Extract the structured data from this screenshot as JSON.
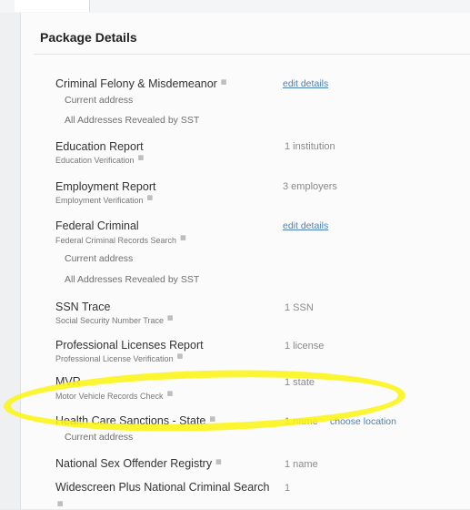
{
  "section": {
    "title": "Package Details"
  },
  "items": [
    {
      "name": "Criminal Felony & Misdemeanor",
      "link": "edit details",
      "lines": [
        "Current address",
        "All Addresses Revealed by SST"
      ]
    },
    {
      "name": "Education Report",
      "sub": "Education Verification",
      "value": "1 institution"
    },
    {
      "name": "Employment Report",
      "sub": "Employment Verification",
      "value": "3 employers"
    },
    {
      "name": "Federal Criminal",
      "sub": "Federal Criminal Records Search",
      "link": "edit details",
      "lines": [
        "Current address",
        "All Addresses Revealed by SST"
      ]
    },
    {
      "name": "SSN Trace",
      "sub": "Social Security Number Trace",
      "value": "1 SSN"
    },
    {
      "name": "Professional Licenses Report",
      "sub": "Professional License Verification",
      "value": "1 license"
    },
    {
      "name": "MVR",
      "sub": "Motor Vehicle Records Check",
      "value": "1 state"
    },
    {
      "name": "Health Care Sanctions - State",
      "value": "1 name",
      "link": "choose location",
      "lines": [
        "Current address"
      ]
    },
    {
      "name": "National Sex Offender Registry",
      "value": "1 name"
    },
    {
      "name": "Widescreen Plus National Criminal Search",
      "value": "1"
    }
  ],
  "icons": {
    "info": "info-icon"
  },
  "colors": {
    "link": "#4d7fb4",
    "highlight": "#f5f014"
  }
}
